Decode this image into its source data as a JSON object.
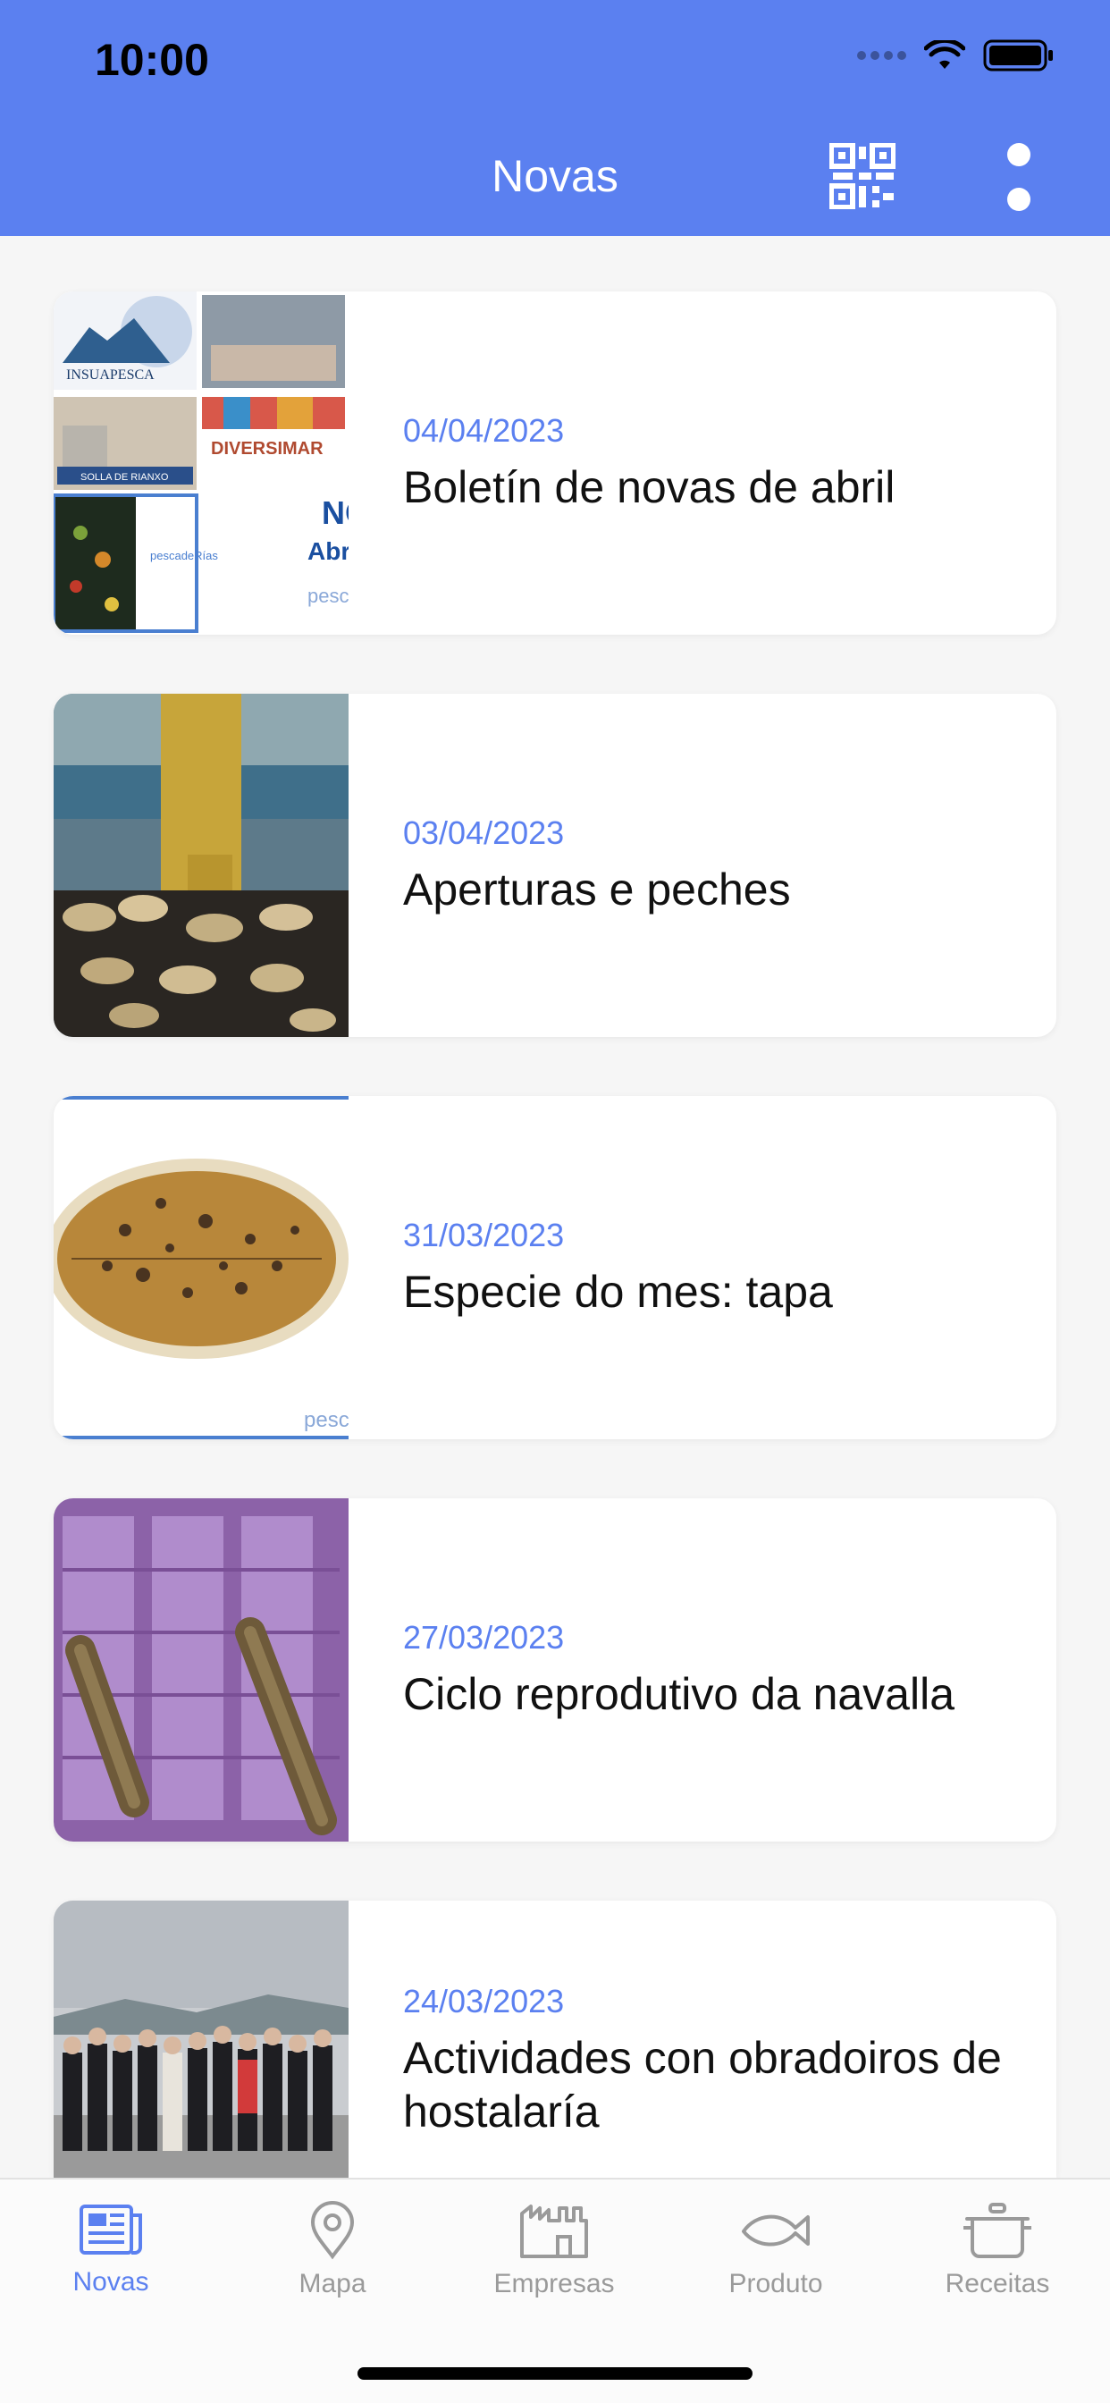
{
  "status_bar": {
    "time": "10:00"
  },
  "header": {
    "title": "Novas",
    "qr_icon": "qr-code-icon",
    "more_icon": "more-vertical-icon"
  },
  "news": [
    {
      "date": "04/04/2023",
      "title": "Boletín de novas de abril",
      "thumb_labels": [
        "INSUAPESCA",
        "DIVERSIMAR",
        "SOLLA DE RIANXO",
        "pescadeRías",
        "NO",
        "Abr",
        "pesc"
      ]
    },
    {
      "date": "03/04/2023",
      "title": "Aperturas e peches",
      "thumb_labels": []
    },
    {
      "date": "31/03/2023",
      "title": "Especie do mes: tapa",
      "thumb_labels": [
        "pesc"
      ]
    },
    {
      "date": "27/03/2023",
      "title": "Ciclo reprodutivo da navalla",
      "thumb_labels": []
    },
    {
      "date": "24/03/2023",
      "title": "Actividades con obradoiros de hostalaría",
      "thumb_labels": []
    }
  ],
  "tabbar": {
    "active": "Novas",
    "items": [
      {
        "label": "Novas",
        "icon": "newspaper-icon"
      },
      {
        "label": "Mapa",
        "icon": "map-pin-icon"
      },
      {
        "label": "Empresas",
        "icon": "factory-icon"
      },
      {
        "label": "Produto",
        "icon": "fish-icon"
      },
      {
        "label": "Receitas",
        "icon": "pot-icon"
      }
    ]
  },
  "colors": {
    "accent": "#5b80f0",
    "inactive": "#9a9a9a"
  }
}
